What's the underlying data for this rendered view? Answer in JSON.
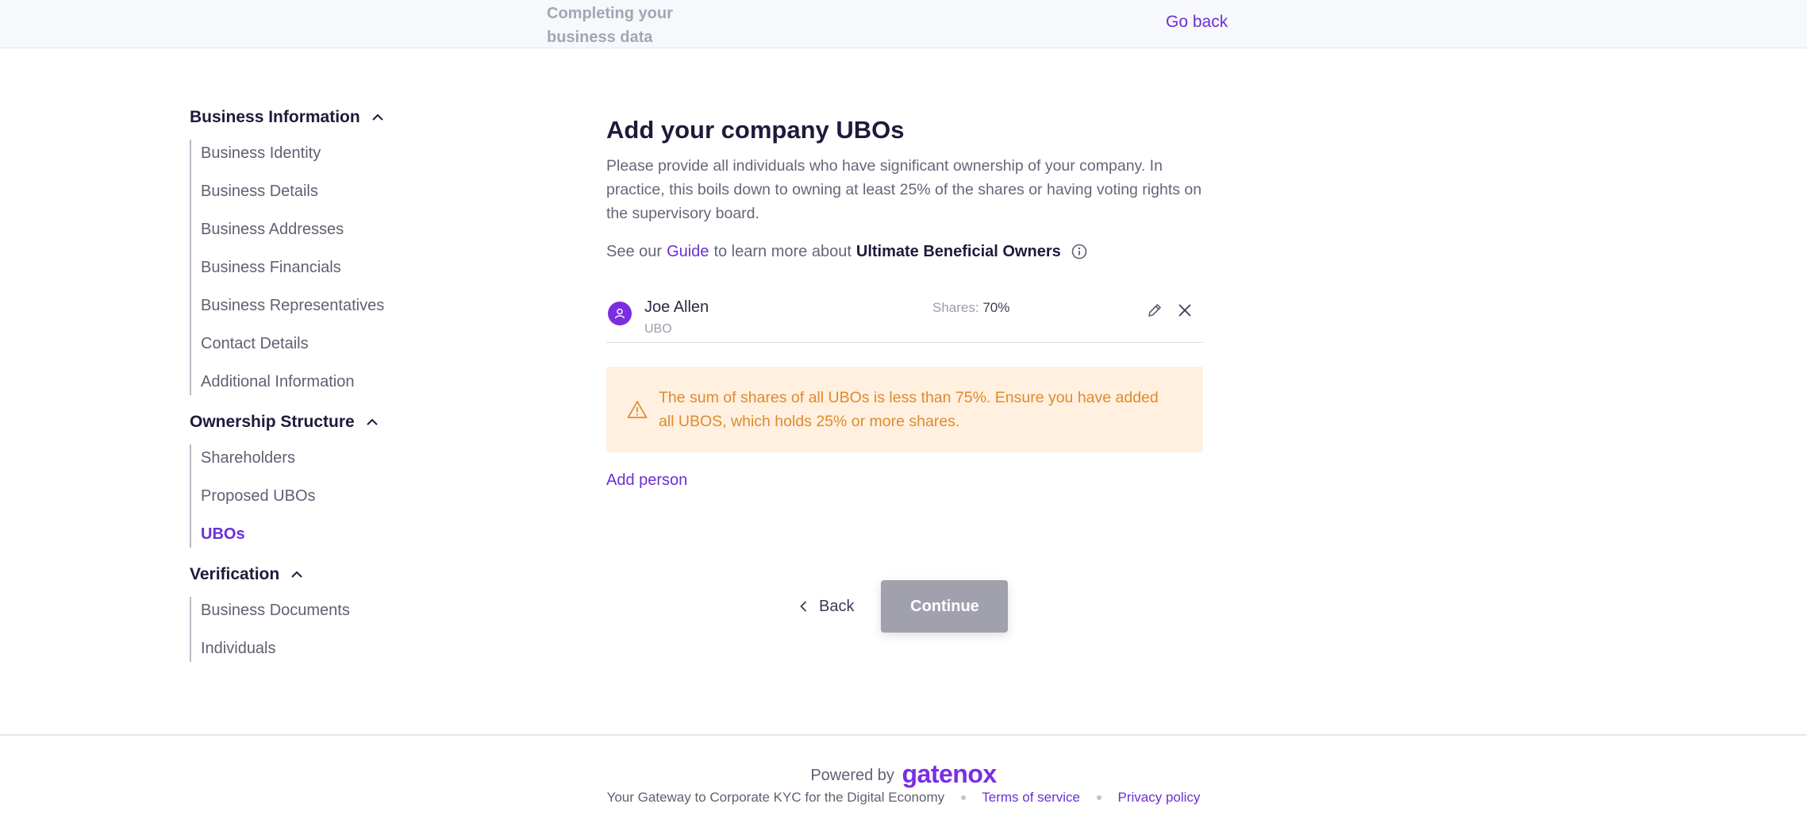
{
  "header": {
    "title": "Completing your business data",
    "go_back": "Go back"
  },
  "sidebar": {
    "sections": [
      {
        "title": "Business Information",
        "items": [
          "Business Identity",
          "Business Details",
          "Business Addresses",
          "Business Financials",
          "Business Representatives",
          "Contact Details",
          "Additional Information"
        ]
      },
      {
        "title": "Ownership Structure",
        "items": [
          "Shareholders",
          "Proposed UBOs",
          "UBOs"
        ]
      },
      {
        "title": "Verification",
        "items": [
          "Business Documents",
          "Individuals"
        ]
      }
    ],
    "active_item": "UBOs"
  },
  "main": {
    "title": "Add your company UBOs",
    "description": "Please provide all individuals who have significant ownership of your company. In practice, this boils down to owning at least 25% of the shares or having voting rights on the supervisory board.",
    "guide_prefix": "See our",
    "guide_link": "Guide",
    "guide_middle": "to learn more about",
    "guide_strong": "Ultimate Beneficial Owners",
    "ubos": [
      {
        "name": "Joe Allen",
        "role": "UBO",
        "shares_label": "Shares:",
        "shares_value": "70%"
      }
    ],
    "alert": "The sum of shares of all UBOs is less than 75%. Ensure you have added all UBOS, which holds 25% or more shares.",
    "add_person": "Add person"
  },
  "actions": {
    "back": "Back",
    "continue": "Continue"
  },
  "footer": {
    "powered_by": "Powered by",
    "brand": "gatenox",
    "tagline": "Your Gateway to Corporate KYC for the Digital Economy",
    "terms": "Terms of service",
    "privacy": "Privacy policy"
  },
  "colors": {
    "accent": "#6b2fd6",
    "alert_bg": "#fff0e0",
    "alert_text": "#e08a2c",
    "button_disabled": "#a1a1ae"
  }
}
